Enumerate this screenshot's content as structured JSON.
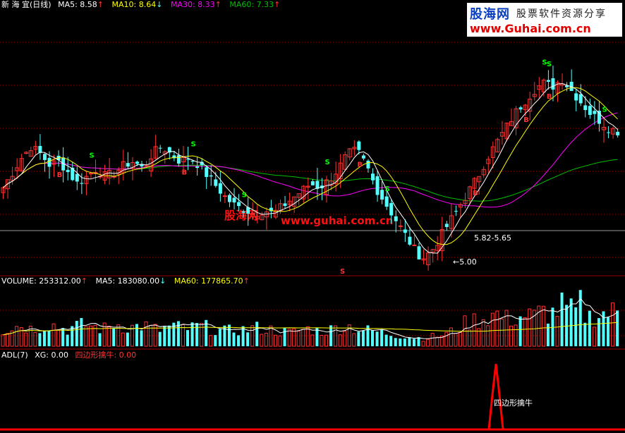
{
  "panels": {
    "price": {
      "stock_label": "新 海 宜(日线)",
      "ma5_label": "MA5: 8.58",
      "ma5_arrow": "↑",
      "ma10_label": "MA10: 8.64",
      "ma10_arrow": "↓",
      "ma30_label": "MA30: 8.33",
      "ma30_arrow": "↑",
      "ma60_label": "MA60: 7.33",
      "ma60_arrow": "↑"
    },
    "volume": {
      "volume_label": "VOLUME: 253312.00",
      "volume_arrow": "↑",
      "ma5_label": "MA5: 183080.00",
      "ma5_arrow": "↓",
      "ma60_label": "MA60: 177865.70",
      "ma60_arrow": "↑"
    },
    "indicator": {
      "adl_label": "ADL(7)",
      "xg_label": "XG: 0.00",
      "signal_label": "四边形擒牛: 0.00",
      "peak_annotation": "四边形擒牛"
    }
  },
  "watermark": {
    "logo_cn": "股海网",
    "logo_slogan": "股票软件资源分享",
    "logo_url": "www.Guhai.com.cn",
    "center_cn": "股海网",
    "center_url": "www.guhai.com.cn"
  },
  "colors": {
    "up": "#ff3232",
    "down": "#54ffff",
    "ma5": "#ffffff",
    "ma10": "#ffff00",
    "ma30": "#ff00ff",
    "ma60": "#00c000",
    "signal": "#ff0000",
    "grid": "#a00000"
  },
  "chart_data": {
    "type": "candlestick",
    "title": "新 海 宜(日线)",
    "annotations": {
      "low_mark": "←5.00",
      "range_mark": "5.82-5.65",
      "sell_marker": "S",
      "buy_marker": "B"
    },
    "series_summary": [
      {
        "name": "MA5",
        "last": 8.58
      },
      {
        "name": "MA10",
        "last": 8.64
      },
      {
        "name": "MA30",
        "last": 8.33
      },
      {
        "name": "MA60",
        "last": 7.33
      },
      {
        "name": "VOLUME",
        "last": 253312.0
      },
      {
        "name": "VOL MA5",
        "last": 183080.0
      },
      {
        "name": "VOL MA60",
        "last": 177865.7
      },
      {
        "name": "XG",
        "last": 0.0
      },
      {
        "name": "四边形擒牛",
        "last": 0.0
      }
    ],
    "close_path": [
      7.0,
      7.4,
      7.8,
      8.1,
      7.9,
      7.6,
      7.7,
      7.4,
      7.1,
      7.3,
      7.5,
      7.3,
      7.4,
      7.6,
      7.7,
      7.5,
      7.9,
      8.1,
      7.9,
      7.7,
      7.8,
      7.6,
      7.3,
      7.0,
      6.7,
      6.5,
      6.4,
      6.3,
      6.4,
      6.3,
      6.5,
      6.7,
      6.9,
      7.1,
      7.0,
      7.2,
      7.5,
      7.9,
      8.0,
      7.6,
      7.0,
      6.6,
      6.2,
      5.8,
      5.4,
      5.1,
      5.3,
      5.7,
      6.1,
      6.5,
      6.9,
      7.3,
      7.8,
      8.2,
      8.6,
      9.0,
      9.3,
      9.6,
      9.8,
      9.7,
      9.9,
      9.6,
      9.3,
      9.0,
      8.8,
      8.6,
      8.5
    ],
    "volume_path": [
      120,
      140,
      160,
      130,
      150,
      170,
      140,
      130,
      150,
      160,
      140,
      130,
      170,
      150,
      140,
      160,
      130,
      120,
      150,
      140,
      130,
      150,
      140,
      120,
      110,
      130,
      120,
      140,
      130,
      120,
      110,
      100,
      120,
      130,
      110,
      120,
      140,
      150,
      130,
      120,
      110,
      100,
      90,
      80,
      70,
      60,
      70,
      80,
      100,
      140,
      180,
      200,
      220,
      240,
      200,
      210,
      230,
      220,
      260,
      240,
      300,
      260,
      250,
      220,
      240,
      250,
      253
    ]
  }
}
